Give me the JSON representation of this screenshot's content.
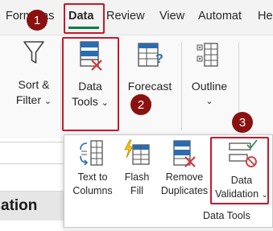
{
  "tabs": {
    "formulas": "Formulas",
    "data": "Data",
    "review": "Review",
    "view": "View",
    "automate": "Automat",
    "help": "He"
  },
  "ribbon": {
    "sort_filter": {
      "line1": "Sort &",
      "line2": "Filter",
      "caret": "⌄"
    },
    "data_tools": {
      "line1": "Data",
      "line2": "Tools",
      "caret": "⌄"
    },
    "forecast": {
      "line1": "Forecast",
      "caret": "⌄"
    },
    "outline": {
      "line1": "Outline",
      "caret": "⌄"
    }
  },
  "panel": {
    "text_to_columns": {
      "line1": "Text to",
      "line2": "Columns"
    },
    "flash_fill": {
      "line1": "Flash",
      "line2": "Fill"
    },
    "remove_duplicates": {
      "line1": "Remove",
      "line2": "Duplicates"
    },
    "data_validation": {
      "line1": "Data",
      "line2": "Validation",
      "caret": "⌄"
    },
    "group_label": "Data Tools"
  },
  "sheet": {
    "cell_text": "ation"
  },
  "steps": [
    "1",
    "2",
    "3"
  ],
  "colors": {
    "accent_green": "#107c41",
    "highlight_red": "#c8182b",
    "badge_red": "#8b1111",
    "icon_blue": "#2b6cb0",
    "icon_red": "#d13438"
  }
}
